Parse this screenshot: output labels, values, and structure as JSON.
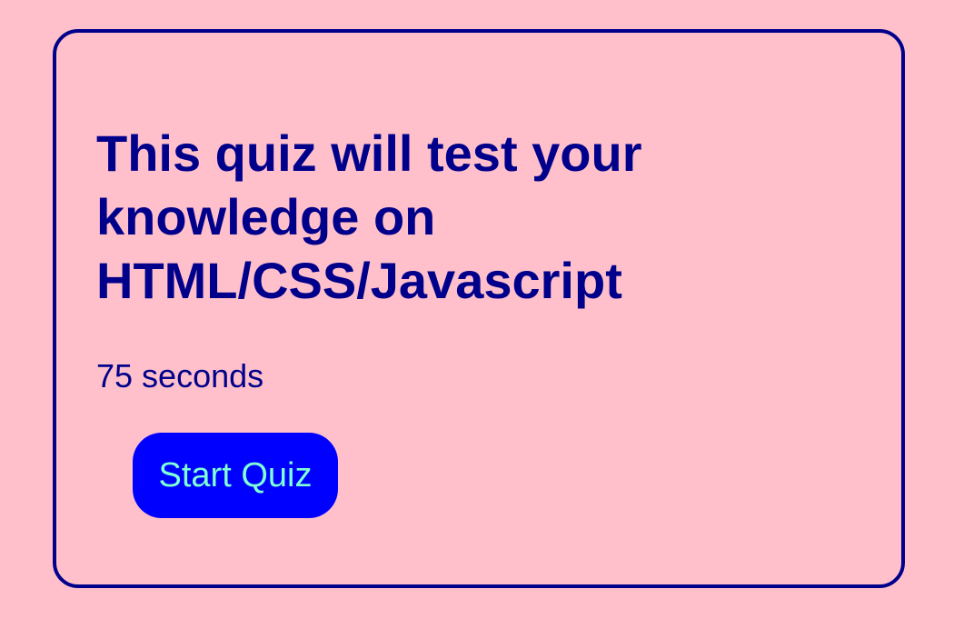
{
  "quiz": {
    "title": "This quiz will test your knowledge on HTML/CSS/Javascript",
    "time_label": "75 seconds",
    "start_button_label": "Start Quiz"
  },
  "colors": {
    "background": "#FFC0CB",
    "primary_text": "#00008B",
    "button_background": "#0000FF",
    "button_text": "#7FFFD4"
  }
}
